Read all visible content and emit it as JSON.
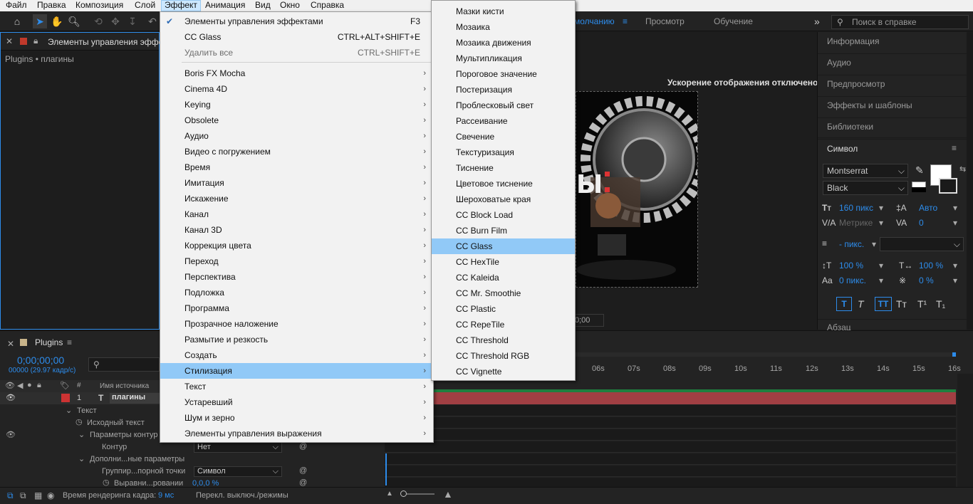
{
  "menubar": [
    "Файл",
    "Правка",
    "Композиция",
    "Слой",
    "Эффект",
    "Анимация",
    "Вид",
    "Окно",
    "Справка"
  ],
  "workspace": {
    "default": "молчанию",
    "review": "Просмотр",
    "learn": "Обучение",
    "more": "»"
  },
  "help_search": {
    "placeholder": "Поиск в справке"
  },
  "effect_controls": {
    "tab": "Элементы управления эффект",
    "breadcrumb": "Plugins • плагины"
  },
  "viewer": {
    "notice": "Ускорение отображения отключено",
    "time": "0;00",
    "image_text": "Ы"
  },
  "right_panel": {
    "items": [
      "Информация",
      "Аудио",
      "Предпросмотр",
      "Эффекты и шаблоны",
      "Библиотеки"
    ],
    "symbol_title": "Символ",
    "font": "Montserrat",
    "style": "Black",
    "size": "160 пикс",
    "leading": "Авто",
    "kerning": "Метрике",
    "tracking": "0",
    "stroke": "- пикс.",
    "vscale": "100 %",
    "hscale": "100 %",
    "baseline": "0 пикс.",
    "tsume": "0 %",
    "para": "Абзац"
  },
  "timeline": {
    "tab": "Plugins",
    "timecode": "0;00;00;00",
    "frames": "00000 (29.97 кадр/с)",
    "col_source": "Имя источника",
    "layer_num": "1",
    "layer_name": "плагины",
    "rows": [
      {
        "label": "Текст"
      },
      {
        "label": "Исходный текст"
      },
      {
        "label": "Параметры контур"
      },
      {
        "label": "Контур",
        "value": "Нет"
      },
      {
        "label": "Дополни...ные параметры"
      },
      {
        "label": "Группир...порной точки",
        "value": "Символ"
      },
      {
        "label": "Выравни...ровании",
        "value": "0,0,0 %"
      }
    ],
    "ruler": [
      "06s",
      "07s",
      "08s",
      "09s",
      "10s",
      "11s",
      "12s",
      "13s",
      "14s",
      "15s",
      "16s"
    ],
    "footer": {
      "render_label": "Время рендеринга кадра:",
      "render_value": "9 мс",
      "toggle": "Перекл. выключ./режимы"
    }
  },
  "effect_menu": {
    "items": [
      {
        "label": "Элементы управления эффектами",
        "shortcut": "F3",
        "checked": true
      },
      {
        "label": "CC Glass",
        "shortcut": "CTRL+ALT+SHIFT+E"
      },
      {
        "label": "Удалить все",
        "shortcut": "CTRL+SHIFT+E",
        "disabled": true
      },
      {
        "label": "Boris FX Mocha"
      },
      {
        "label": "Cinema 4D"
      },
      {
        "label": "Keying"
      },
      {
        "label": "Obsolete"
      },
      {
        "label": "Аудио"
      },
      {
        "label": "Видео с погружением"
      },
      {
        "label": "Время"
      },
      {
        "label": "Имитация"
      },
      {
        "label": "Искажение"
      },
      {
        "label": "Канал"
      },
      {
        "label": "Канал 3D"
      },
      {
        "label": "Коррекция цвета"
      },
      {
        "label": "Переход"
      },
      {
        "label": "Перспектива"
      },
      {
        "label": "Подложка"
      },
      {
        "label": "Программа"
      },
      {
        "label": "Прозрачное наложение"
      },
      {
        "label": "Размытие и резкость"
      },
      {
        "label": "Создать"
      },
      {
        "label": "Стилизация",
        "highlighted": true
      },
      {
        "label": "Текст"
      },
      {
        "label": "Устаревший"
      },
      {
        "label": "Шум и зерно"
      },
      {
        "label": "Элементы управления выражения"
      }
    ]
  },
  "stylize_submenu": {
    "items": [
      "Мазки кисти",
      "Мозаика",
      "Мозаика движения",
      "Мультипликация",
      "Пороговое значение",
      "Постеризация",
      "Проблесковый свет",
      "Рассеивание",
      "Свечение",
      "Текстуризация",
      "Тиснение",
      "Цветовое тиснение",
      "Шероховатые края",
      "CC Block Load",
      "CC Burn Film",
      "CC Glass",
      "CC HexTile",
      "CC Kaleida",
      "CC Mr. Smoothie",
      "CC Plastic",
      "CC RepeTile",
      "CC Threshold",
      "CC Threshold RGB",
      "CC Vignette"
    ],
    "highlighted": "CC Glass"
  },
  "colors": {
    "accent": "#2d8ceb",
    "menu_highlight": "#91c9f7",
    "layer_bar": "#a13f43"
  }
}
